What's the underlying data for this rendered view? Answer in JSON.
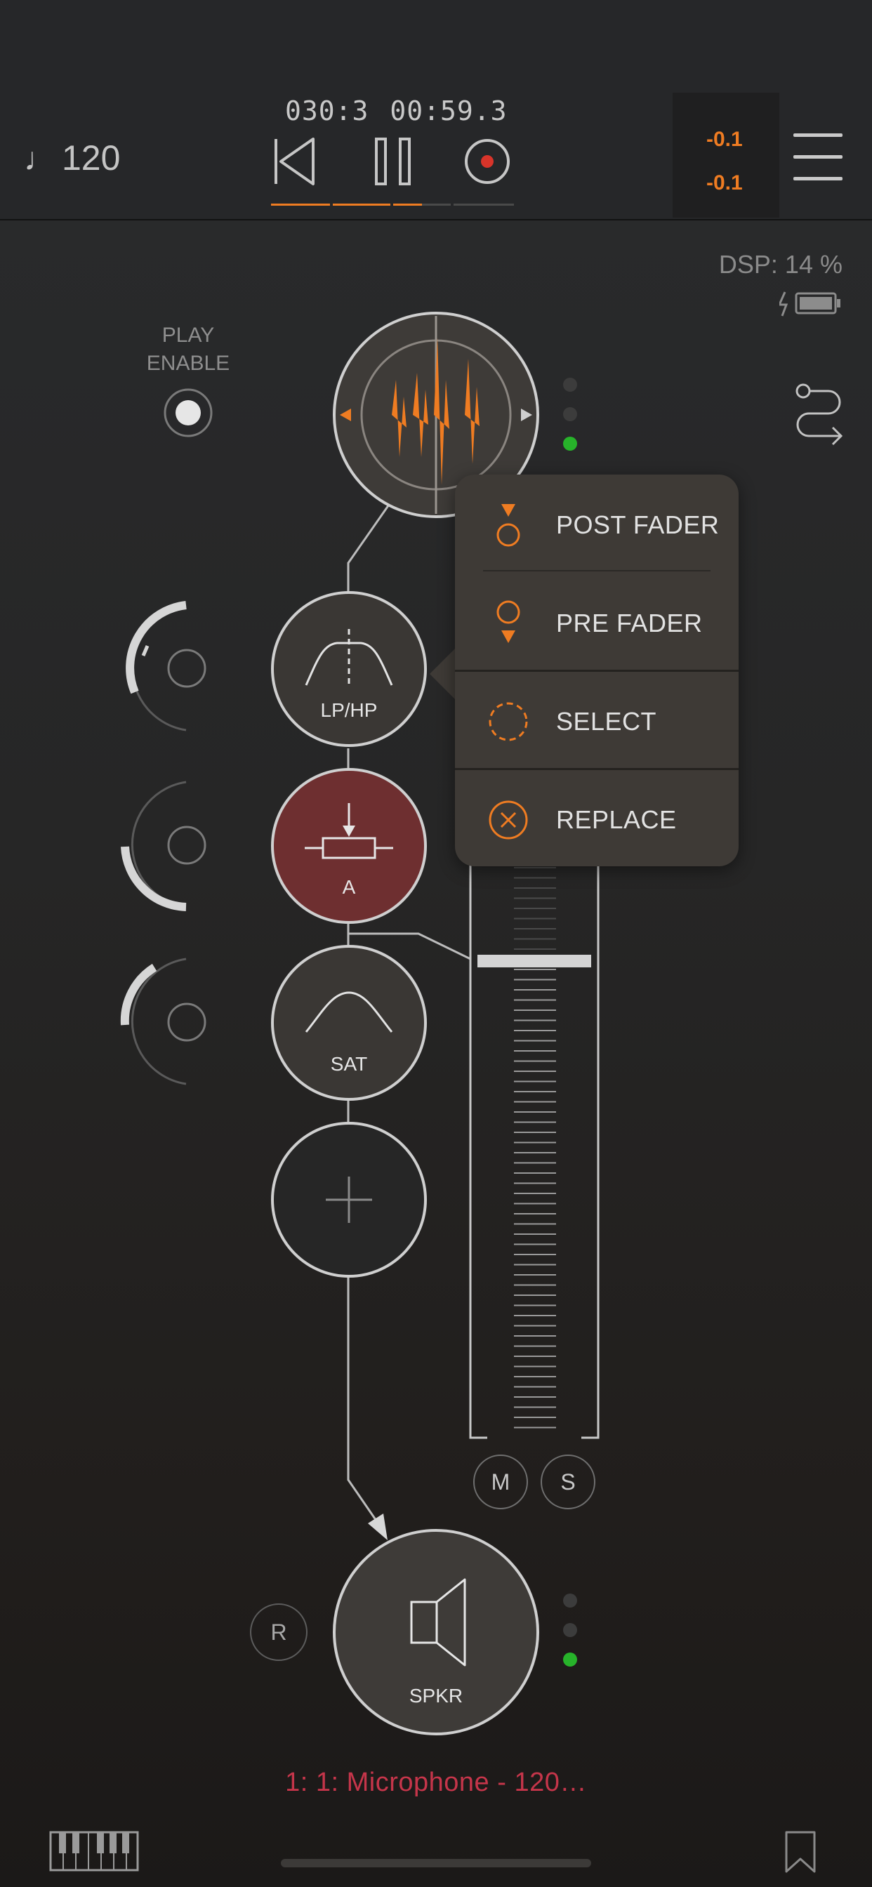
{
  "header": {
    "tempo": "120",
    "tempo_icon": "quarter-note-icon",
    "bar_counter": "030:3",
    "time_counter": "00:59.3",
    "level_top": "-0.1",
    "level_bottom": "-0.1",
    "progress_fraction": 0.62,
    "accent_color": "#ef7c22"
  },
  "status": {
    "dsp": "DSP: 14 %",
    "battery_icon": "battery-charging-icon"
  },
  "play_enable": {
    "line1": "PLAY",
    "line2": "ENABLE"
  },
  "chain": {
    "modules": [
      {
        "label": "LP/HP",
        "icon": "filter-icon"
      },
      {
        "label": "A",
        "icon": "attenuator-icon",
        "color": "#6e2f30"
      },
      {
        "label": "SAT",
        "icon": "saturation-curve-icon"
      }
    ],
    "add_icon": "plus-icon",
    "output_label": "SPKR",
    "output_icon": "speaker-icon"
  },
  "popup": {
    "items": [
      {
        "label": "POST FADER",
        "icon": "post-fader-icon"
      },
      {
        "label": "PRE FADER",
        "icon": "pre-fader-icon"
      },
      {
        "label": "SELECT",
        "icon": "select-dashed-circle-icon"
      },
      {
        "label": "REPLACE",
        "icon": "replace-x-circle-icon"
      }
    ]
  },
  "fader": {
    "mute_label": "M",
    "solo_label": "S"
  },
  "record_arm_label": "R",
  "track_name": "1: 1: Microphone  - 120…",
  "footer": {
    "left_icon": "piano-keyboard-icon",
    "right_icon": "bookmark-icon"
  }
}
